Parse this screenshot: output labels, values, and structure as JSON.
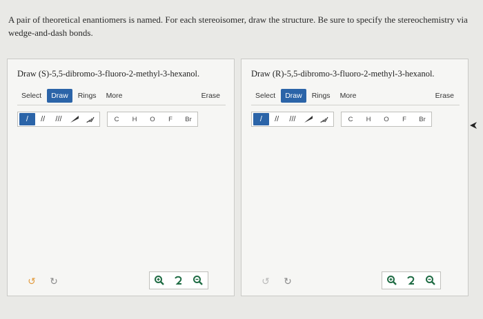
{
  "question": "A pair of theoretical enantiomers is named. For each stereoisomer, draw the structure. Be sure to specify the stereochemistry via wedge-and-dash bonds.",
  "panels": [
    {
      "title": "Draw (S)-5,5-dibromo-3-fluoro-2-methyl-3-hexanol.",
      "tabs": {
        "select": "Select",
        "draw": "Draw",
        "rings": "Rings",
        "more": "More",
        "erase": "Erase"
      },
      "bonds": [
        "/",
        "//",
        "///",
        "wedge",
        "dash"
      ],
      "atoms": [
        "C",
        "H",
        "O",
        "F",
        "Br"
      ]
    },
    {
      "title": "Draw (R)-5,5-dibromo-3-fluoro-2-methyl-3-hexanol.",
      "tabs": {
        "select": "Select",
        "draw": "Draw",
        "rings": "Rings",
        "more": "More",
        "erase": "Erase"
      },
      "bonds": [
        "/",
        "//",
        "///",
        "wedge",
        "dash"
      ],
      "atoms": [
        "C",
        "H",
        "O",
        "F",
        "Br"
      ]
    }
  ],
  "glyphs": {
    "single": "/",
    "double": "//",
    "triple": "///",
    "undo": "↺",
    "redo": "↻"
  },
  "colors": {
    "accent": "#2b64a8",
    "undo": "#e29a3c",
    "zoom": "#1e6b43"
  },
  "icons": [
    "undo-icon",
    "redo-icon",
    "zoom-in-icon",
    "reset-icon",
    "zoom-out-icon",
    "pointer-arrow-icon"
  ]
}
